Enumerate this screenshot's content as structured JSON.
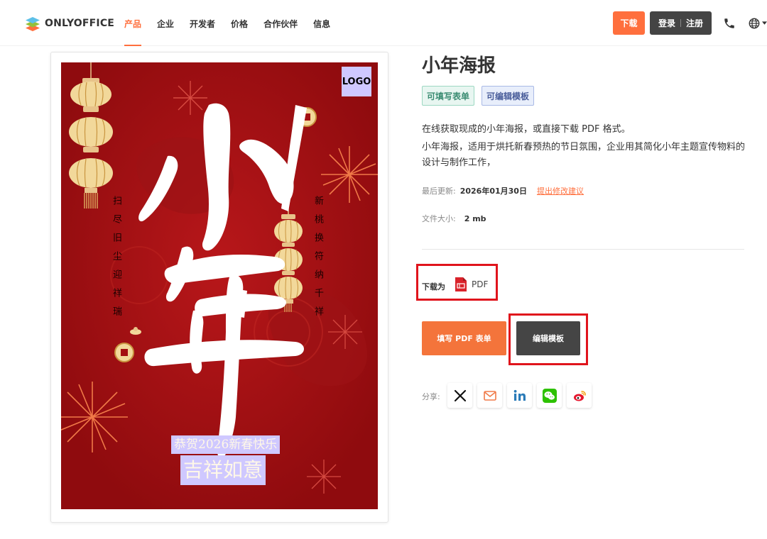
{
  "header": {
    "logo_text": "ONLYOFFICE",
    "nav": [
      {
        "label": "产品",
        "active": true
      },
      {
        "label": "企业"
      },
      {
        "label": "开发者"
      },
      {
        "label": "价格"
      },
      {
        "label": "合作伙伴"
      },
      {
        "label": "信息"
      }
    ],
    "download_label": "下载",
    "login_label": "登录",
    "register_label": "注册",
    "accent_color": "#ff6f3d"
  },
  "preview": {
    "logo_placeholder": "LOGO",
    "vertical_left": "扫尽旧尘迎祥瑞",
    "vertical_right": "新桃换符纳千祥",
    "greeting_1": "恭贺2026新春快乐",
    "greeting_2": "吉祥如意"
  },
  "details": {
    "title": "小年海报",
    "tags": [
      "可填写表单",
      "可编辑模板"
    ],
    "description_1": "在线获取现成的小年海报，或直接下载 PDF 格式。",
    "description_2": "小年海报，适用于烘托新春预热的节日氛围，企业用其简化小年主题宣传物料的设计与制作工作，",
    "last_updated_label": "最后更新:",
    "last_updated_value": "2026年01月30日",
    "suggest_edit_link": "提出修改建议",
    "file_size_label": "文件大小:",
    "file_size_value": "2 mb",
    "download_as_label": "下载为",
    "format_label": "PDF",
    "fill_button_label": "填写 PDF 表单",
    "edit_button_label": "编辑模板",
    "share_label": "分享:",
    "share_icons": [
      "x-icon",
      "mail-icon",
      "linkedin-icon",
      "wechat-icon",
      "weibo-icon"
    ]
  }
}
